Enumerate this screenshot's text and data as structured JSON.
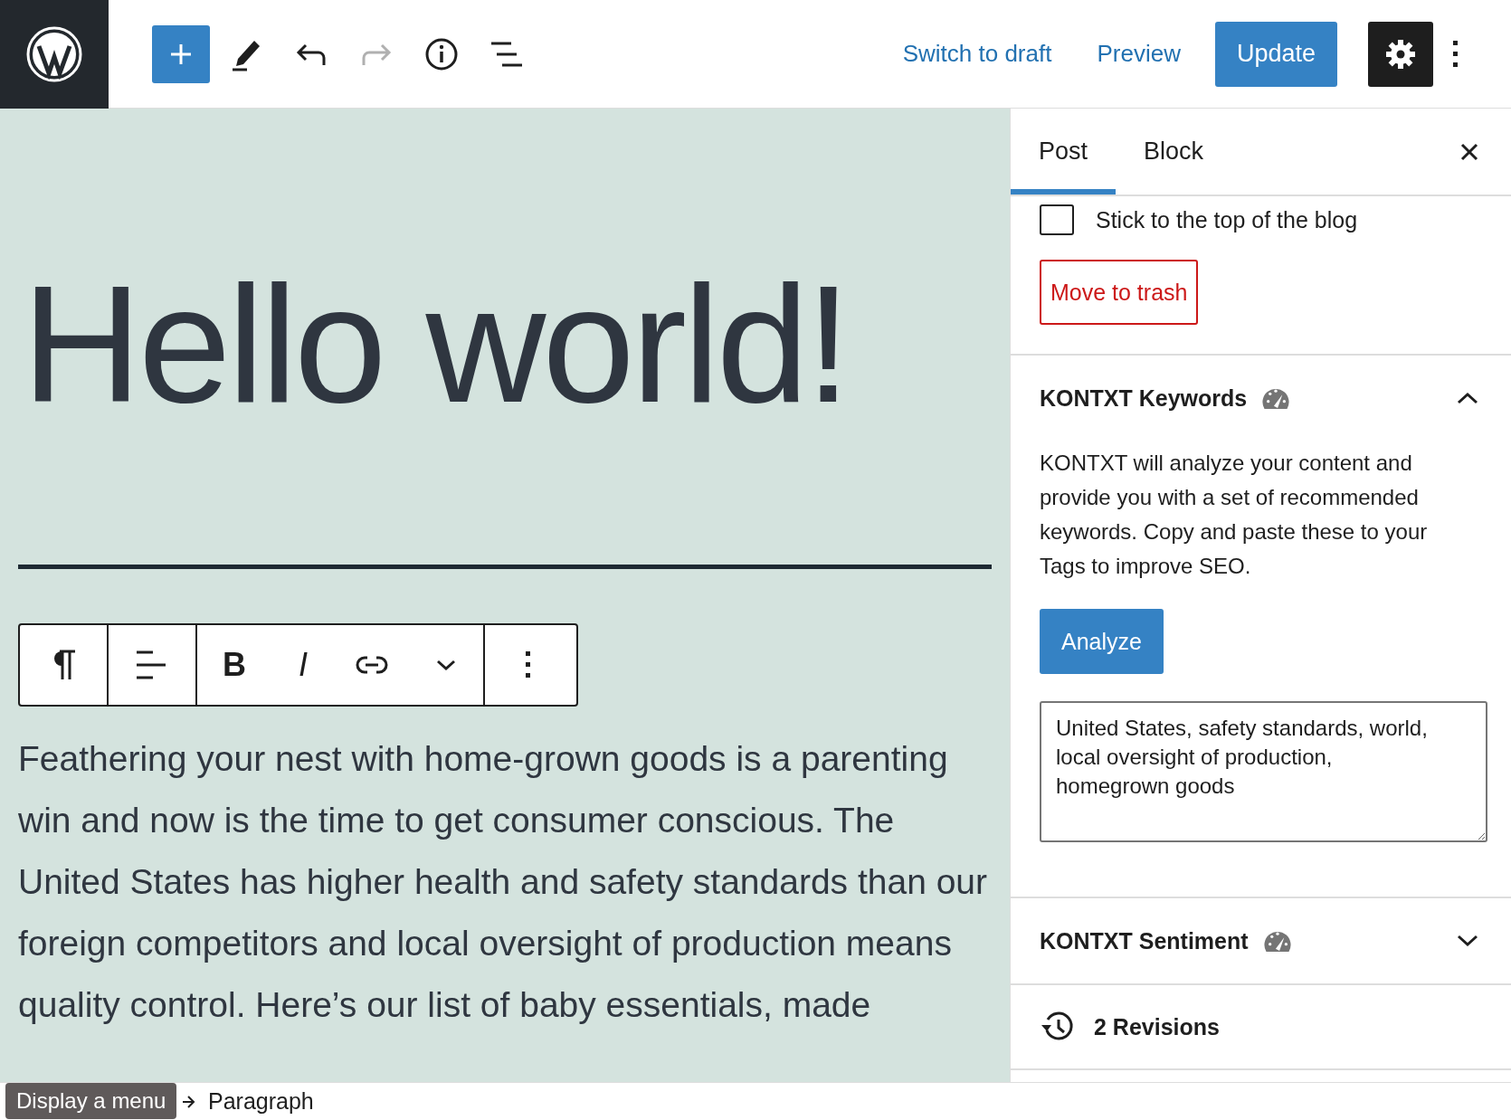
{
  "toolbar": {
    "buttons": [
      {
        "kind": "add",
        "disabled": false
      },
      {
        "kind": "edit",
        "disabled": false
      },
      {
        "kind": "undo",
        "disabled": false
      },
      {
        "kind": "redo",
        "disabled": true
      },
      {
        "kind": "info",
        "disabled": false
      },
      {
        "kind": "outline",
        "disabled": false
      }
    ],
    "switch_to_draft": "Switch to draft",
    "preview": "Preview",
    "update": "Update",
    "settings_selected": true
  },
  "editor": {
    "title": "Hello world!",
    "block_toolbar": [
      {
        "kind": "paragraph"
      },
      {
        "kind": "align"
      },
      {
        "kind": "bold",
        "label": "B"
      },
      {
        "kind": "italic",
        "label": "I"
      },
      {
        "kind": "link"
      },
      {
        "kind": "more"
      },
      {
        "kind": "options"
      }
    ],
    "paragraph": "Feathering your nest with home-grown goods is a parenting win and now is the time to get consumer conscious. The United States has higher health and safety standards than our foreign competitors and local oversight of production means quality control. Here’s our list of baby essentials, made"
  },
  "sidebar": {
    "tabs": [
      {
        "label": "Post",
        "selected": true
      },
      {
        "label": "Block",
        "selected": false
      }
    ],
    "sticky": {
      "label": "Stick to the top of the blog",
      "checked": false
    },
    "trash": "Move to trash",
    "panels": [
      {
        "kind": "keywords",
        "title": "KONTXT Keywords",
        "expanded": true,
        "description": "KONTXT will analyze your content and provide you with a set of recommended keywords. Copy and paste these to your Tags to improve SEO.",
        "button": "Analyze",
        "result": "United States, safety standards, world, local oversight of production, homegrown goods"
      },
      {
        "kind": "sentiment",
        "title": "KONTXT Sentiment",
        "expanded": false
      }
    ],
    "revisions": "2 Revisions"
  },
  "footer": {
    "breadcrumb": "Paragraph",
    "tooltip": "Display a menu"
  }
}
